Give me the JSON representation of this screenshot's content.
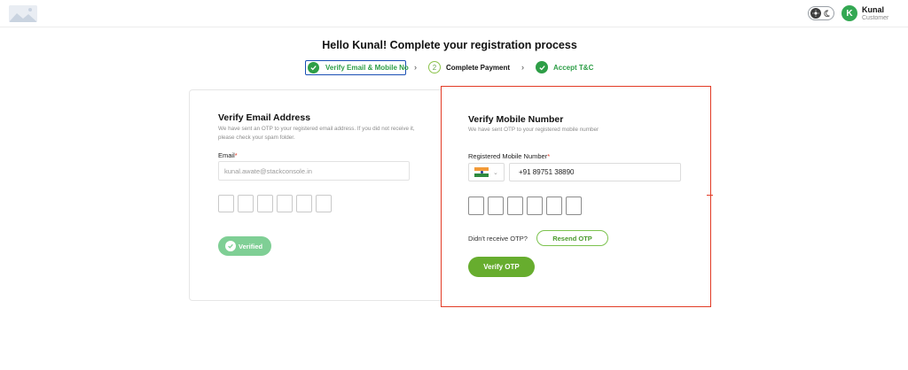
{
  "header": {
    "logo_icon": "image-placeholder-icon",
    "theme_toggle_icons": [
      "sun-icon",
      "moon-icon"
    ],
    "avatar_initial": "K",
    "user_name": "Kunal",
    "user_role": "Customer"
  },
  "page": {
    "title": "Hello Kunal! Complete your registration process"
  },
  "stepper": {
    "steps": [
      {
        "label": "Verify Email & Mobile No",
        "state": "completed",
        "icon": "check-circle-icon"
      },
      {
        "label": "Complete Payment",
        "number": "2",
        "state": "pending"
      },
      {
        "label": "Accept T&C",
        "state": "completed",
        "icon": "check-circle-icon"
      }
    ],
    "separator_icon": "chevron-right-icon",
    "separator": "›"
  },
  "email_card": {
    "title": "Verify Email Address",
    "description": "We have sent an OTP to your registered email address. If you did not receive it, please check your spam folder.",
    "email_label": "Email",
    "required_mark": "*",
    "email_value": "kunal.awate@stackconsole.in",
    "otp_length": 6,
    "verified_label": "Verified"
  },
  "mobile_card": {
    "title": "Verify Mobile Number",
    "description": "We have sent OTP to your registered mobile number",
    "phone_label": "Registered Mobile Number",
    "required_mark": "*",
    "country_flag": "india-flag-icon",
    "country_chevron": "⌄",
    "phone_value": "+91 89751 38890",
    "otp_length": 6,
    "resend_prompt": "Didn't receive OTP?",
    "resend_label": "Resend OTP",
    "verify_label": "Verify OTP"
  },
  "colors": {
    "accent_green": "#67ad2e",
    "success_green": "#2e9e47",
    "verified_green": "#7fcf95",
    "highlight_red": "#e23b26",
    "step_border_blue": "#1a4fb5"
  }
}
